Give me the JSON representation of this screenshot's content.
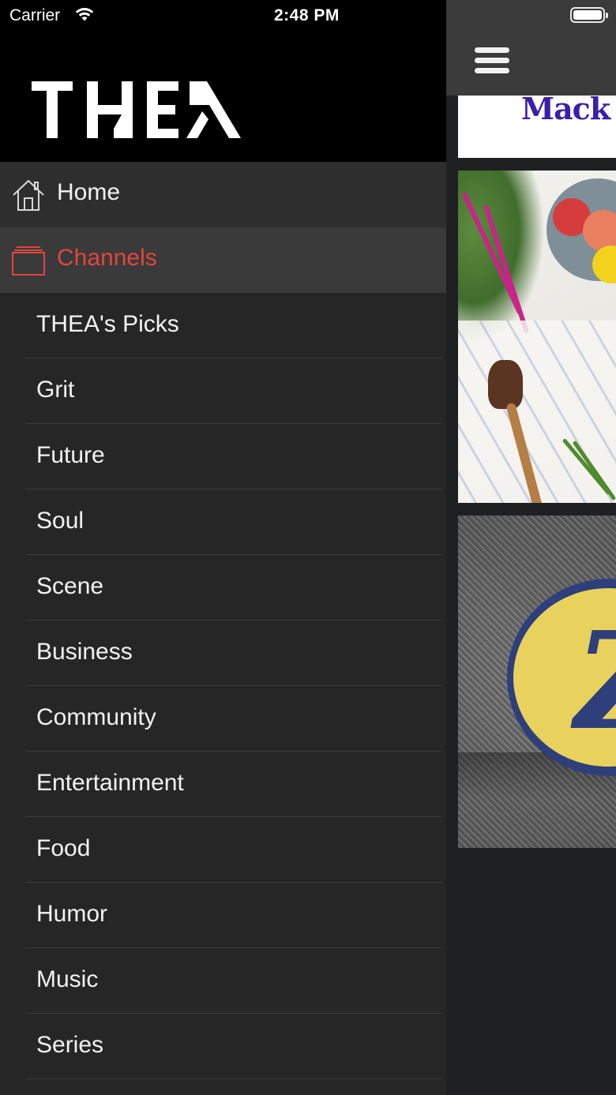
{
  "status_bar": {
    "carrier": "Carrier",
    "time": "2:48 PM"
  },
  "brand": {
    "logo_text": "THEA"
  },
  "menu": {
    "home_label": "Home",
    "channels_label": "Channels",
    "active_color": "#e2463c",
    "channels": [
      "THEA's Picks",
      "Grit",
      "Future",
      "Soul",
      "Scene",
      "Business",
      "Community",
      "Entertainment",
      "Food",
      "Humor",
      "Music",
      "Series"
    ]
  },
  "content": {
    "card_1_visible_text": "Mack"
  }
}
